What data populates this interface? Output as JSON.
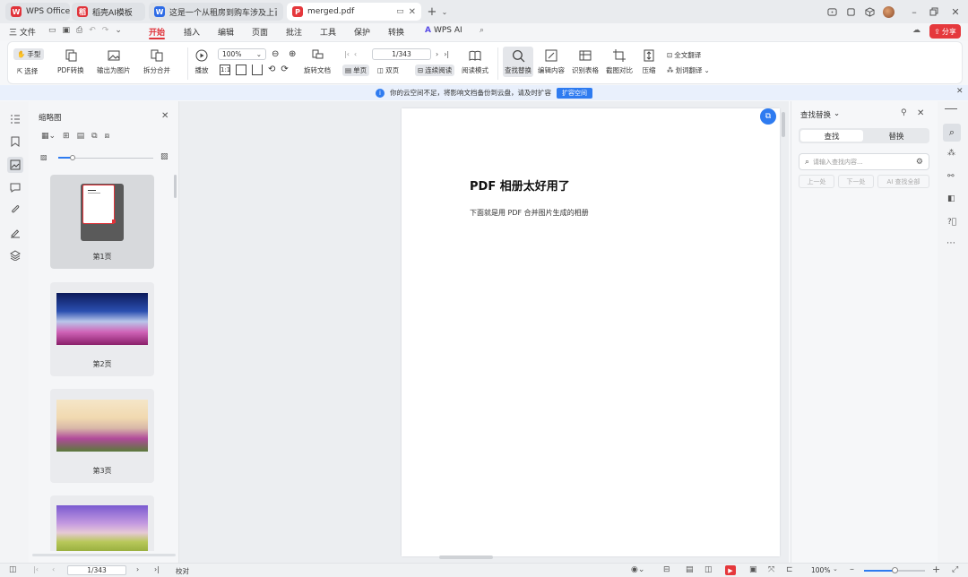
{
  "tabs": [
    {
      "label": "WPS Office",
      "icon": "wps-logo-icon",
      "color": "#e0333a"
    },
    {
      "label": "稻壳AI模板",
      "icon": "docer-icon",
      "color": "#e0333a"
    },
    {
      "label": "这是一个从租房到购车涉及上百行业",
      "icon": "word-icon",
      "color": "#2e6be6"
    },
    {
      "label": "merged.pdf",
      "icon": "pdf-icon",
      "color": "#e5383c"
    }
  ],
  "menu": {
    "file": "三 文件",
    "items": [
      "开始",
      "插入",
      "编辑",
      "页面",
      "批注",
      "工具",
      "保护",
      "转换"
    ],
    "wps_ai": "WPS AI",
    "share": "分享"
  },
  "ribbon": {
    "hand": "手型",
    "select": "选择",
    "pdf_convert": "PDF转换",
    "export_image": "输出为图片",
    "split_merge": "拆分合并",
    "play": "播放",
    "zoom": "100%",
    "rotate": "旋转文档",
    "single": "单页",
    "double": "双页",
    "continuous": "连续阅读",
    "read_mode": "阅读模式",
    "page_input": "1/343",
    "find_replace": "查找替换",
    "edit_content": "编辑内容",
    "recognize_table": "识别表格",
    "screenshot_compare": "截图对比",
    "compress": "压缩",
    "full_translate": "全文翻译",
    "word_translate": "划词翻译"
  },
  "notice": {
    "text": "你的云空间不足，将影响文档备份到云盘，请及时扩容",
    "button": "扩容空间"
  },
  "thumbnails": {
    "title": "缩略图",
    "pages": [
      "第1页",
      "第2页",
      "第3页"
    ]
  },
  "document": {
    "title": "PDF 相册太好用了",
    "body": "下面就是用 PDF 合并图片生成的相册"
  },
  "find": {
    "title": "查找替换",
    "tab_find": "查找",
    "tab_replace": "替换",
    "placeholder": "请输入查找内容...",
    "prev": "上一处",
    "next": "下一处",
    "replace_all": "AI 查找全部"
  },
  "status": {
    "page": "1/343",
    "proof": "校对",
    "zoom": "100%"
  }
}
